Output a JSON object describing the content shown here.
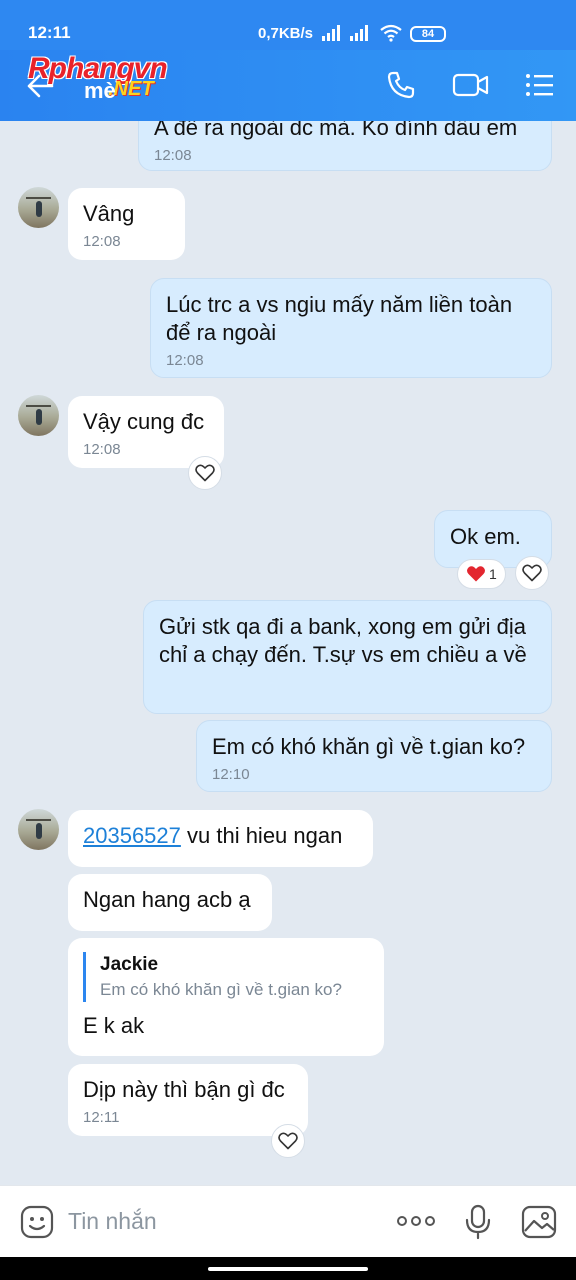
{
  "status_bar": {
    "time": "12:11",
    "speed": "0,7KB/s",
    "battery": "84"
  },
  "header": {
    "title": "mè",
    "watermark_main": "Rphangvn",
    "watermark_suffix": ".NET",
    "icons": [
      "back-arrow-icon",
      "phone-icon",
      "video-call-icon",
      "menu-icon"
    ]
  },
  "messages": [
    {
      "dir": "out",
      "text": "A để ra ngoài dc mà. Ko dính dầu em",
      "time": "12:08"
    },
    {
      "dir": "in",
      "text": "Vâng",
      "time": "12:08"
    },
    {
      "dir": "out",
      "text": "Lúc trc a vs ngiu mấy năm liền toàn để ra ngoài",
      "time": "12:08"
    },
    {
      "dir": "in",
      "text": "Vậy cung đc",
      "time": "12:08"
    },
    {
      "dir": "out",
      "text": "Ok em.",
      "reaction_count": "1"
    },
    {
      "dir": "out",
      "text": "Gửi stk qa đi a bank, xong em gửi địa chỉ a chạy đến. T.sự vs em chiều a về"
    },
    {
      "dir": "out",
      "text": "Em có khó khăn gì về t.gian ko?",
      "time": "12:10"
    },
    {
      "dir": "in",
      "link": "20356527",
      "text": " vu thi hieu ngan"
    },
    {
      "dir": "in",
      "text": "Ngan hang acb ạ"
    },
    {
      "dir": "in",
      "quote_name": "Jackie",
      "quote_text": "Em có khó khăn gì về t.gian ko?",
      "text": "E k ak"
    },
    {
      "dir": "in",
      "text": "Dịp này thì bận gì đc",
      "time": "12:11"
    }
  ],
  "input": {
    "placeholder": "Tin nhắn"
  },
  "colors": {
    "header": "#2e88f1",
    "background": "#e2e9f1",
    "outgoing_bubble": "#d7ecfe",
    "incoming_bubble": "#ffffff",
    "link": "#1d80d8"
  }
}
